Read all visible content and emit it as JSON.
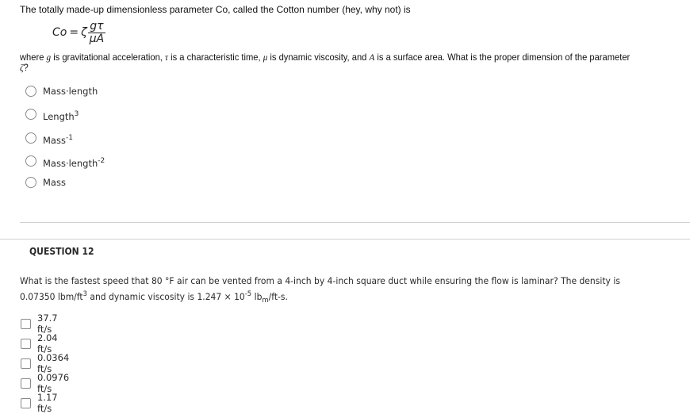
{
  "question11": {
    "intro": "The totally made-up dimensionless parameter Co, called the Cotton number (hey, why not) is",
    "formula": {
      "lhs": "Co",
      "equals": "=",
      "coefficient": "ζ",
      "numerator": "gτ",
      "denominator": "μA"
    },
    "description": {
      "p1": "where ",
      "g": "g",
      "p2": " is gravitational acceleration, ",
      "tau": "τ",
      "p3": " is a characteristic time, ",
      "mu": "μ",
      "p4": " is dynamic viscosity, and ",
      "A": "A",
      "p5": " is a surface area. What is the proper dimension of the parameter ",
      "zeta": "ζ",
      "p6": "?"
    },
    "options": [
      {
        "base": "Mass·length",
        "sup": "",
        "selected": false
      },
      {
        "base": "Length",
        "sup": "3",
        "selected": false
      },
      {
        "base": "Mass",
        "sup": "-1",
        "selected": false
      },
      {
        "base": "Mass·length",
        "sup": "-2",
        "selected": false
      },
      {
        "base": "Mass",
        "sup": "",
        "selected": false
      }
    ]
  },
  "question12": {
    "title": "QUESTION 12",
    "text": {
      "line1": "What is the fastest speed that 80 °F air can be vented from a 4-inch by 4-inch square duct while ensuring the flow is laminar? The density is",
      "density_value": "0.07350 lbm/ft",
      "density_exp": "3",
      "mid": " and dynamic viscosity is 1.247 × 10",
      "visc_exp": "-5",
      "unit_base": " lb",
      "unit_sub": "m",
      "unit_tail": "/ft-s."
    },
    "options": [
      {
        "label": "37.7 ft/s",
        "checked": false
      },
      {
        "label": "2.04 ft/s",
        "checked": false
      },
      {
        "label": "0.0364 ft/s",
        "checked": false
      },
      {
        "label": "0.0976 ft/s",
        "checked": false
      },
      {
        "label": "1.17 ft/s",
        "checked": false
      }
    ]
  }
}
